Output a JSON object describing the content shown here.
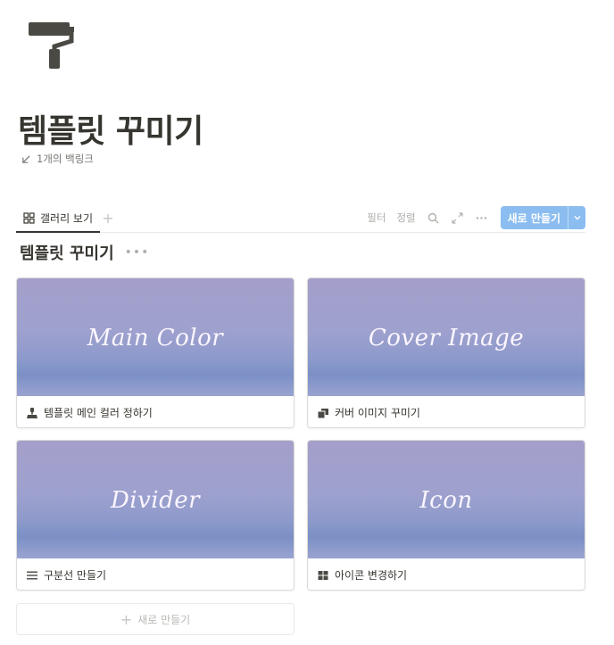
{
  "page": {
    "icon": "paint-roller-icon",
    "title": "템플릿 꾸미기",
    "backlinks": "1개의 백링크"
  },
  "view_bar": {
    "active_tab": "갤러리 보기",
    "filter": "필터",
    "sort": "정렬",
    "new_button": "새로 만들기"
  },
  "database": {
    "title": "템플릿 꾸미기",
    "cards": [
      {
        "cover_text": "Main Color",
        "title": "템플릿 메인 컬러 정하기",
        "icon": "paint-bucket-icon"
      },
      {
        "cover_text": "Cover Image",
        "title": "커버 이미지 꾸미기",
        "icon": "image-stack-icon"
      },
      {
        "cover_text": "Divider",
        "title": "구분선 만들기",
        "icon": "list-icon"
      },
      {
        "cover_text": "Icon",
        "title": "아이콘 변경하기",
        "icon": "grid-icon"
      }
    ],
    "new_card_label": "새로 만들기"
  },
  "colors": {
    "accent": "#8bbdf0",
    "text": "#37352f",
    "muted": "#787774",
    "cover_top": "#a49fca",
    "cover_band": "#7b90c6"
  }
}
